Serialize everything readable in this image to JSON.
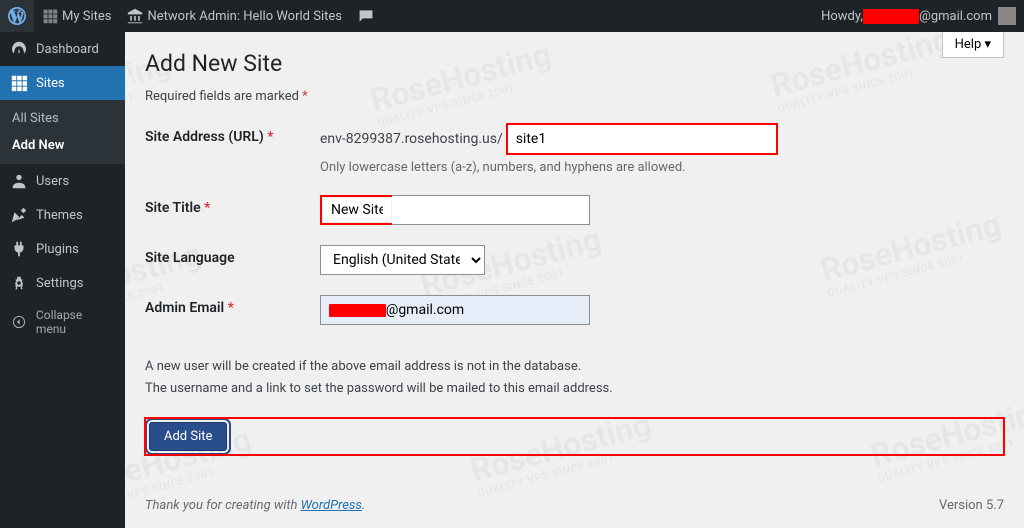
{
  "adminbar": {
    "mysites": "My Sites",
    "network": "Network Admin: Hello World Sites",
    "howdy": "Howdy,",
    "email_suffix": "@gmail.com"
  },
  "sidebar": {
    "dashboard": "Dashboard",
    "sites": "Sites",
    "all_sites": "All Sites",
    "add_new": "Add New",
    "users": "Users",
    "themes": "Themes",
    "plugins": "Plugins",
    "settings": "Settings",
    "collapse": "Collapse menu"
  },
  "page": {
    "help": "Help",
    "title": "Add New Site",
    "required_note": "Required fields are marked",
    "labels": {
      "site_address": "Site Address (URL)",
      "site_title": "Site Title",
      "site_language": "Site Language",
      "admin_email": "Admin Email"
    },
    "site_prefix": "env-8299387.rosehosting.us/",
    "site_address_value": "site1",
    "site_address_desc": "Only lowercase letters (a-z), numbers, and hyphens are allowed.",
    "site_title_value": "New Site",
    "site_language_value": "English (United States)",
    "admin_email_suffix": "@gmail.com",
    "info1": "A new user will be created if the above email address is not in the database.",
    "info2": "The username and a link to set the password will be mailed to this email address.",
    "submit": "Add Site"
  },
  "footer": {
    "thanks_pre": "Thank you for creating with ",
    "wp": "WordPress",
    "version": "Version 5.7"
  }
}
